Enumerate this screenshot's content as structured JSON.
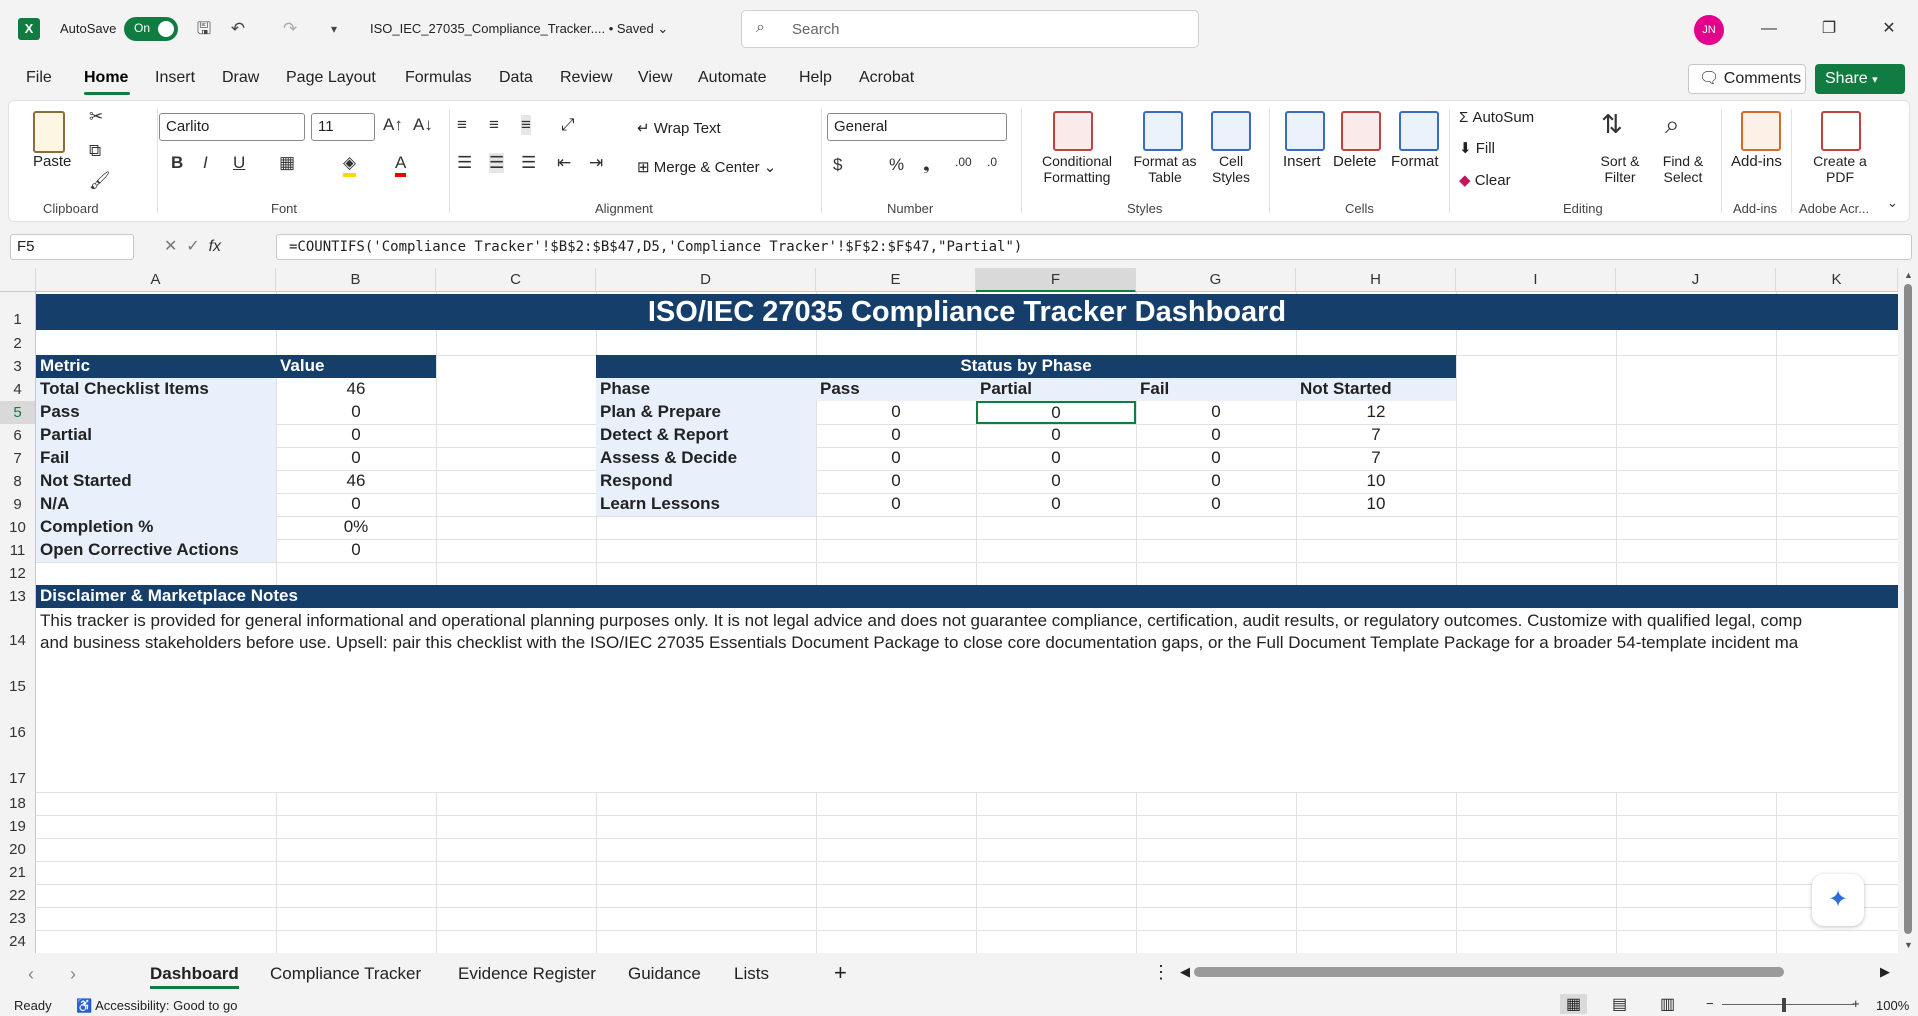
{
  "titlebar": {
    "app_logo": "X",
    "autosave_label": "AutoSave",
    "autosave_state": "On",
    "document_name": "ISO_IEC_27035_Compliance_Tracker....",
    "save_status": "• Saved",
    "search_placeholder": "Search",
    "user_initials": "JN"
  },
  "menu": {
    "items": [
      "File",
      "Home",
      "Insert",
      "Draw",
      "Page Layout",
      "Formulas",
      "Data",
      "Review",
      "View",
      "Automate",
      "Help",
      "Acrobat"
    ],
    "active": "Home",
    "comments_label": "Comments",
    "share_label": "Share"
  },
  "ribbon": {
    "clipboard": {
      "paste": "Paste",
      "label": "Clipboard"
    },
    "font": {
      "name": "Carlito",
      "size": "11",
      "label": "Font"
    },
    "alignment": {
      "wrap_text": "Wrap Text",
      "merge_center": "Merge & Center",
      "label": "Alignment"
    },
    "number": {
      "format": "General",
      "label": "Number"
    },
    "styles": {
      "conditional": "Conditional Formatting",
      "format_table": "Format as Table",
      "cell_styles": "Cell Styles",
      "label": "Styles"
    },
    "cells": {
      "insert": "Insert",
      "delete": "Delete",
      "format": "Format",
      "label": "Cells"
    },
    "editing": {
      "autosum": "AutoSum",
      "fill": "Fill",
      "clear": "Clear",
      "sort_filter": "Sort & Filter",
      "find_select": "Find & Select",
      "label": "Editing"
    },
    "addins": {
      "addins": "Add-ins",
      "label": "Add-ins"
    },
    "adobe": {
      "create_pdf": "Create a PDF",
      "label": "Adobe Acr..."
    }
  },
  "formula_bar": {
    "name_box": "F5",
    "formula": "=COUNTIFS('Compliance Tracker'!$B$2:$B$47,D5,'Compliance Tracker'!$F$2:$F$47,\"Partial\")"
  },
  "columns": [
    "A",
    "B",
    "C",
    "D",
    "E",
    "F",
    "G",
    "H",
    "I",
    "J",
    "K"
  ],
  "rows": [
    "1",
    "2",
    "3",
    "4",
    "5",
    "6",
    "7",
    "8",
    "9",
    "10",
    "11",
    "12",
    "13",
    "14",
    "15",
    "16",
    "17",
    "18",
    "19",
    "20",
    "21",
    "22",
    "23",
    "24"
  ],
  "sheet": {
    "title": "ISO/IEC 27035 Compliance Tracker Dashboard",
    "metrics_header": {
      "metric": "Metric",
      "value": "Value"
    },
    "metrics": [
      {
        "label": "Total Checklist Items",
        "value": "46"
      },
      {
        "label": "Pass",
        "value": "0"
      },
      {
        "label": "Partial",
        "value": "0"
      },
      {
        "label": "Fail",
        "value": "0"
      },
      {
        "label": "Not Started",
        "value": "46"
      },
      {
        "label": "N/A",
        "value": "0"
      },
      {
        "label": "Completion %",
        "value": "0%"
      },
      {
        "label": "Open Corrective Actions",
        "value": "0"
      }
    ],
    "phase_table": {
      "title": "Status by Phase",
      "headers": [
        "Phase",
        "Pass",
        "Partial",
        "Fail",
        "Not Started"
      ],
      "rows": [
        {
          "phase": "Plan & Prepare",
          "pass": "0",
          "partial": "0",
          "fail": "0",
          "not_started": "12"
        },
        {
          "phase": "Detect & Report",
          "pass": "0",
          "partial": "0",
          "fail": "0",
          "not_started": "7"
        },
        {
          "phase": "Assess & Decide",
          "pass": "0",
          "partial": "0",
          "fail": "0",
          "not_started": "7"
        },
        {
          "phase": "Respond",
          "pass": "0",
          "partial": "0",
          "fail": "0",
          "not_started": "10"
        },
        {
          "phase": "Learn Lessons",
          "pass": "0",
          "partial": "0",
          "fail": "0",
          "not_started": "10"
        }
      ]
    },
    "disclaimer": {
      "title": "Disclaimer & Marketplace Notes",
      "line1": "This tracker is provided for general informational and operational planning purposes only. It is not legal advice and does not guarantee compliance, certification, audit results, or regulatory outcomes. Customize with qualified legal, comp",
      "line2": "and business stakeholders before use. Upsell: pair this checklist with the ISO/IEC 27035 Essentials Document Package to close core documentation gaps, or the Full Document Template Package for a broader 54-template incident ma"
    }
  },
  "tabs": [
    "Dashboard",
    "Compliance Tracker",
    "Evidence Register",
    "Guidance",
    "Lists"
  ],
  "active_tab": "Dashboard",
  "status": {
    "ready": "Ready",
    "accessibility": "Accessibility: Good to go",
    "zoom": "100%"
  }
}
